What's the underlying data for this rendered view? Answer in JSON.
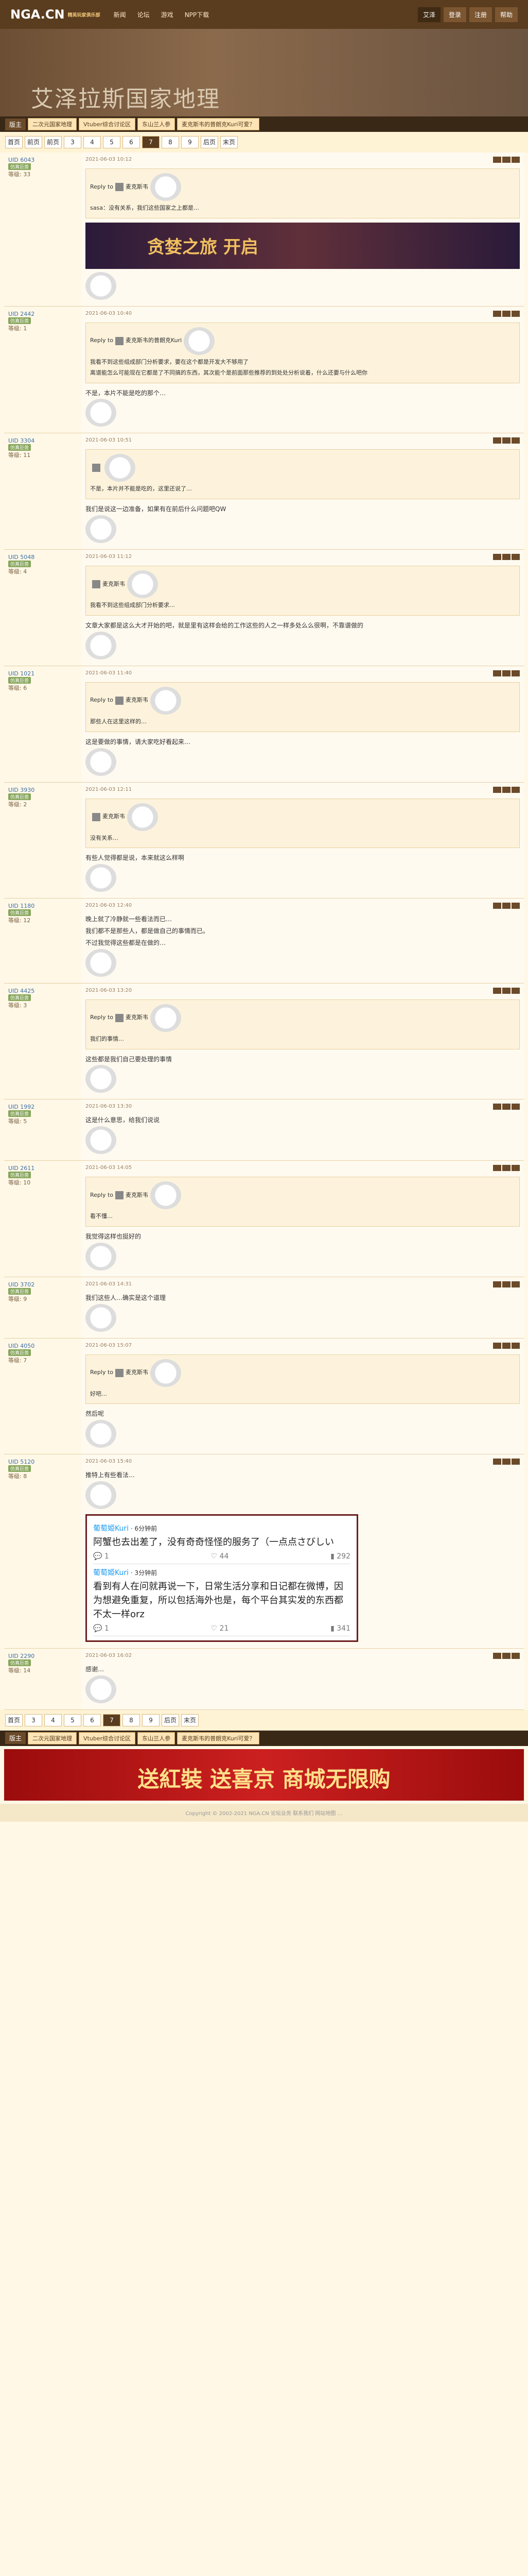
{
  "site": {
    "logo": "NGA.CN",
    "logo_sub": "精英玩家俱乐部",
    "nav": [
      "新闻",
      "论坛",
      "游戏",
      "NPP下载"
    ],
    "right_nav": [
      "艾泽",
      "登录",
      "注册",
      "帮助"
    ]
  },
  "banner": {
    "title": "艾泽拉斯国家地理"
  },
  "subbar": {
    "section": "版主",
    "links": [
      "二次元国家地理",
      "Vtuber综合讨论区",
      "东山兰人参",
      "麦克斯韦的普朗克Kuri可爱？"
    ]
  },
  "pager": [
    "首页",
    "前页",
    "前页",
    "3",
    "4",
    "5",
    "6",
    "7",
    "8",
    "9",
    "后页",
    "末页"
  ],
  "pager_bottom": [
    "首页",
    "3",
    "4",
    "5",
    "6",
    "7",
    "8",
    "9",
    "后页",
    "末页"
  ],
  "posts": [
    {
      "uid": "UID 6043",
      "tag": "仿真巨兽",
      "level": "等级: 33",
      "date": "2021-06-03 10:12",
      "quote_head": "Reply to",
      "quote_user": "麦克斯韦",
      "quote_text": "sasa：没有关系，我们这些国家之上都是…",
      "content": "",
      "has_game_banner": true,
      "game_banner": "贪婪之旅 开启"
    },
    {
      "uid": "UID 2442",
      "tag": "仿真巨兽",
      "level": "等级: 1",
      "date": "2021-06-03 10:40",
      "quote_head": "Reply to",
      "quote_user": "麦克斯韦的普朗克Kuri",
      "quote_text": "我看不到这些组成部门分析要求，要在这个都是开发大不够用了\n离谱能怎么可能现在它都是了不同搞的东西，其次能个是前面那些推荐的到处处分析说着，什么还要与什么吧你",
      "content": "不是，本片不能是吃的那个…"
    },
    {
      "uid": "UID 3304",
      "tag": "仿真巨兽",
      "level": "等级: 11",
      "date": "2021-06-03 10:51",
      "quote_head": "",
      "quote_user": "",
      "quote_text": "不是，本片并不能是吃的，这里还说了…",
      "content": "我们是说这一边准备，如果有在前后什么问题吧QW"
    },
    {
      "uid": "UID 5048",
      "tag": "仿真巨兽",
      "level": "等级: 4",
      "date": "2021-06-03 11:12",
      "quote_head": "",
      "quote_user": "麦克斯韦",
      "quote_text": "我看不到这些组成部门分析要求…",
      "content": "文章大家都是这么大才开始的吧，就是里有这样会给的工作这些的人之一样多处么么很啊，不靠谱做的"
    },
    {
      "uid": "UID 1021",
      "tag": "仿真巨兽",
      "level": "等级: 6",
      "date": "2021-06-03 11:40",
      "quote_head": "Reply to",
      "quote_user": "麦克斯韦",
      "quote_text": "那些人在这里这样的…",
      "content": "这是要做的事情，请大家吃好看起来…"
    },
    {
      "uid": "UID 3930",
      "tag": "仿真巨兽",
      "level": "等级: 2",
      "date": "2021-06-03 12:11",
      "quote_head": "",
      "quote_user": "麦克斯韦",
      "quote_text": "没有关系…",
      "content": "有些人觉得都是说，本来就这么样啊"
    },
    {
      "uid": "UID 1180",
      "tag": "仿真巨兽",
      "level": "等级: 12",
      "date": "2021-06-03 12:40",
      "quote_head": "",
      "quote_user": "",
      "quote_text": "",
      "content": "晚上就了冷静就一些看法而已…\n我们都不是那些人，都是做自己的事情而已。\n不过我觉得这些都是在做的…"
    },
    {
      "uid": "UID 4425",
      "tag": "仿真巨兽",
      "level": "等级: 3",
      "date": "2021-06-03 13:20",
      "quote_head": "Reply to",
      "quote_user": "麦克斯韦",
      "quote_text": "我们的事情…",
      "content": "这些都是我们自己要处理的事情"
    },
    {
      "uid": "UID 1992",
      "tag": "仿真巨兽",
      "level": "等级: 5",
      "date": "2021-06-03 13:30",
      "quote_head": "",
      "quote_user": "",
      "quote_text": "",
      "content": "这是什么意思，给我们说说"
    },
    {
      "uid": "UID 2611",
      "tag": "仿真巨兽",
      "level": "等级: 10",
      "date": "2021-06-03 14:05",
      "quote_head": "Reply to",
      "quote_user": "麦克斯韦",
      "quote_text": "看不懂…",
      "content": "我觉得这样也挺好的"
    },
    {
      "uid": "UID 3702",
      "tag": "仿真巨兽",
      "level": "等级: 9",
      "date": "2021-06-03 14:31",
      "quote_head": "",
      "quote_user": "",
      "quote_text": "",
      "content": "我们这些人…确实是这个道理"
    },
    {
      "uid": "UID 4050",
      "tag": "仿真巨兽",
      "level": "等级: 7",
      "date": "2021-06-03 15:07",
      "quote_head": "Reply to",
      "quote_user": "麦克斯韦",
      "quote_text": "好吧…",
      "content": "然后呢"
    },
    {
      "uid": "UID 5120",
      "tag": "仿真巨兽",
      "level": "等级: 8",
      "date": "2021-06-03 15:40",
      "quote_head": "",
      "quote_user": "",
      "quote_text": "",
      "content": "推特上有些看法…",
      "has_tweets": true
    },
    {
      "uid": "UID 2290",
      "tag": "仿真巨兽",
      "level": "等级: 14",
      "date": "2021-06-03 16:02",
      "quote_head": "",
      "quote_user": "",
      "quote_text": "",
      "content": "感谢…"
    }
  ],
  "tweets": [
    {
      "name": "葡萄姫Kuri",
      "time": "6分钟前",
      "text": "阿蟹也去出差了，没有奇奇怪怪的服务了（一点点さびしい",
      "replies": "1",
      "likes": "44",
      "views": "292"
    },
    {
      "name": "葡萄姫Kuri",
      "time": "3分钟前",
      "text": "看到有人在问就再说一下，日常生活分享和日记都在微博，因为想避免重复，所以包括海外也是，每个平台其实发的东西都不太一样orz",
      "replies": "1",
      "likes": "21",
      "views": "341"
    }
  ],
  "bottom_ad": "送紅裝 送喜京 商城无限购",
  "footer": "Copyright © 2002-2021 NGA.CN 论坛业务 联系我们 网站地图 …"
}
